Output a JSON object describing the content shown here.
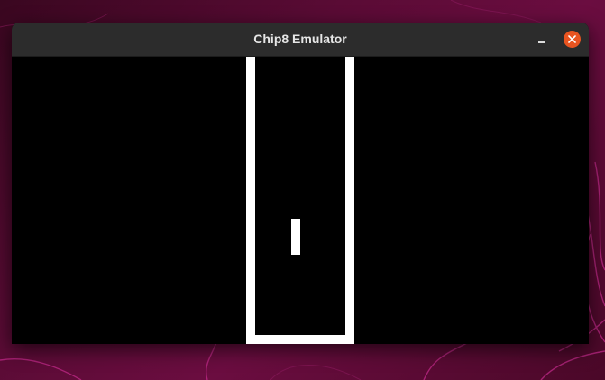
{
  "window": {
    "title": "Chip8 Emulator"
  },
  "titlebar_buttons": {
    "minimize_icon": "minimize-icon",
    "close_icon": "close-icon"
  },
  "colors": {
    "desktop_background": "#5a0b35",
    "titlebar": "#2c2c2c",
    "close_button": "#e95420",
    "screen_background": "#000000",
    "pixel_on": "#ffffff"
  }
}
